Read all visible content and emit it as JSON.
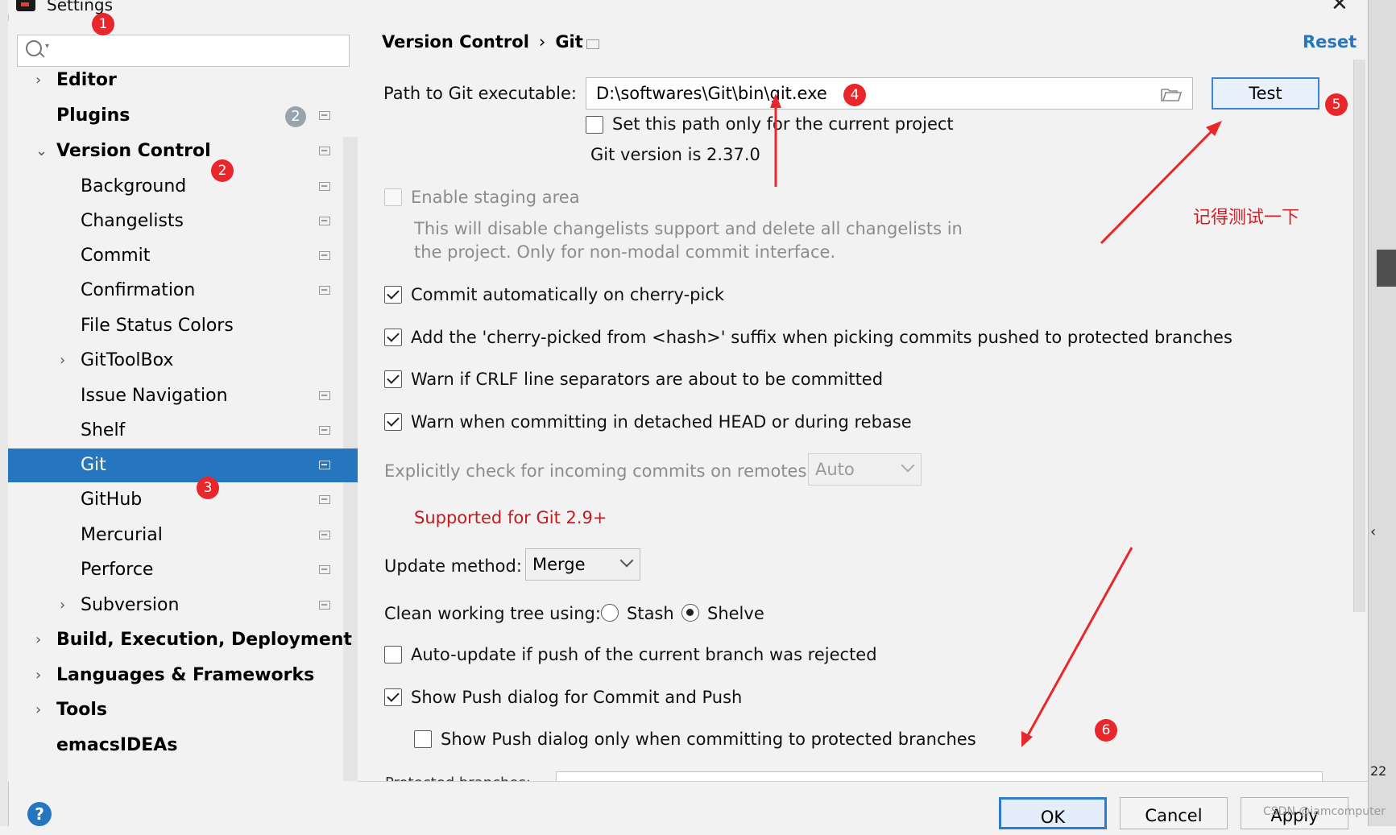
{
  "window": {
    "title": "Settings",
    "close_symbol": "✕"
  },
  "sidebar": {
    "search_placeholder": "",
    "items": [
      {
        "label": "Editor",
        "arrow": "›",
        "bold": true
      },
      {
        "label": "Plugins",
        "bold": true,
        "badge": "2"
      },
      {
        "label": "Version Control",
        "arrow": "⌄",
        "bold": true
      },
      {
        "label": "Background"
      },
      {
        "label": "Changelists"
      },
      {
        "label": "Commit"
      },
      {
        "label": "Confirmation"
      },
      {
        "label": "File Status Colors"
      },
      {
        "label": "GitToolBox",
        "arrow": "›"
      },
      {
        "label": "Issue Navigation"
      },
      {
        "label": "Shelf"
      },
      {
        "label": "Git",
        "selected": true
      },
      {
        "label": "GitHub"
      },
      {
        "label": "Mercurial"
      },
      {
        "label": "Perforce"
      },
      {
        "label": "Subversion",
        "arrow": "›"
      },
      {
        "label": "Build, Execution, Deployment",
        "arrow": "›",
        "bold": true
      },
      {
        "label": "Languages & Frameworks",
        "arrow": "›",
        "bold": true
      },
      {
        "label": "Tools",
        "arrow": "›",
        "bold": true
      },
      {
        "label": "emacsIDEAs",
        "bold": true
      }
    ]
  },
  "header": {
    "crumb_1": "Version Control",
    "crumb_sep": "›",
    "crumb_2": "Git",
    "reset_label": "Reset"
  },
  "git": {
    "path_label": "Path to Git executable:",
    "path_value": "D:\\softwares\\Git\\bin\\git.exe",
    "test_label": "Test",
    "current_project_label": "Set this path only for the current project",
    "version_text": "Git version is 2.37.0",
    "staging_label": "Enable staging area",
    "staging_desc_1": "This will disable changelists support and delete all changelists in",
    "staging_desc_2": "the project. Only for non-modal commit interface.",
    "opt_cherry_pick": "Commit automatically on cherry-pick",
    "opt_suffix": "Add the 'cherry-picked from <hash>' suffix when picking commits pushed to protected branches",
    "opt_crlf": "Warn if CRLF line separators are about to be committed",
    "opt_detached": "Warn when committing in detached HEAD or during rebase",
    "incoming_label": "Explicitly check for incoming commits on remotes:",
    "incoming_value": "Auto",
    "supported_note": "Supported for Git 2.9+",
    "update_label": "Update method:",
    "update_value": "Merge",
    "clean_label": "Clean working tree using:",
    "radio_stash": "Stash",
    "radio_shelve": "Shelve",
    "opt_auto_update": "Auto-update if push of the current branch was rejected",
    "opt_show_push": "Show Push dialog for Commit and Push",
    "opt_push_protected": "Show Push dialog only when committing to protected branches",
    "protected_partial": "Protected branches:"
  },
  "buttons": {
    "ok": "OK",
    "cancel": "Cancel",
    "apply": "Apply",
    "help": "?"
  },
  "annotations": {
    "n1": "1",
    "n2": "2",
    "n3": "3",
    "n4": "4",
    "n5": "5",
    "n6": "6",
    "test_note": "记得测试一下",
    "watermark": "CSDN @iamcomputer"
  },
  "colors": {
    "selection": "#2675bf",
    "annotation_red": "#e8262b",
    "link_blue": "#2675bf",
    "note_red": "#d0202a"
  },
  "right_strip_chars": [
    "‹",
    "22"
  ]
}
